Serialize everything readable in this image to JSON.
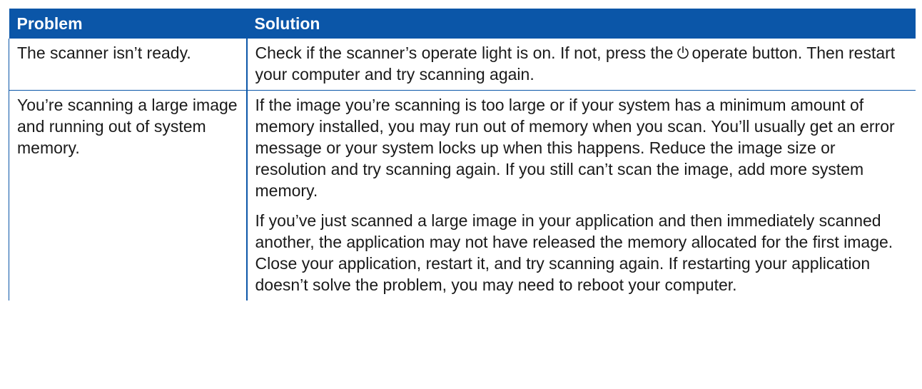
{
  "table": {
    "headers": {
      "problem": "Problem",
      "solution": "Solution"
    },
    "rows": [
      {
        "problem": "The scanner isn’t ready.",
        "solution_before_icon": "Check if the scanner’s operate light is on. If not, press the",
        "icon": "power-icon",
        "solution_after_icon": "operate button. Then restart your computer and try scanning again."
      },
      {
        "problem": "You’re scanning a large image and running out of system memory.",
        "solution_paragraphs": [
          "If the image you’re scanning is too large or if your system has a minimum amount of memory installed, you may run out of memory when you scan. You’ll usually get an error message or your system locks up when this happens. Reduce the image size or resolution and try scanning again. If you still can’t scan the image, add more system memory.",
          "If you’ve just scanned a large image in your application and then immediately scanned another, the application may not have released the memory allocated for the first image. Close your application, restart it, and try scanning again. If restarting your application doesn’t solve the problem, you may need to reboot your computer."
        ]
      }
    ]
  },
  "colors": {
    "header_background": "#0b56a8",
    "header_text": "#ffffff",
    "body_text": "#1a1a1a",
    "rule": "#0b56a8"
  }
}
